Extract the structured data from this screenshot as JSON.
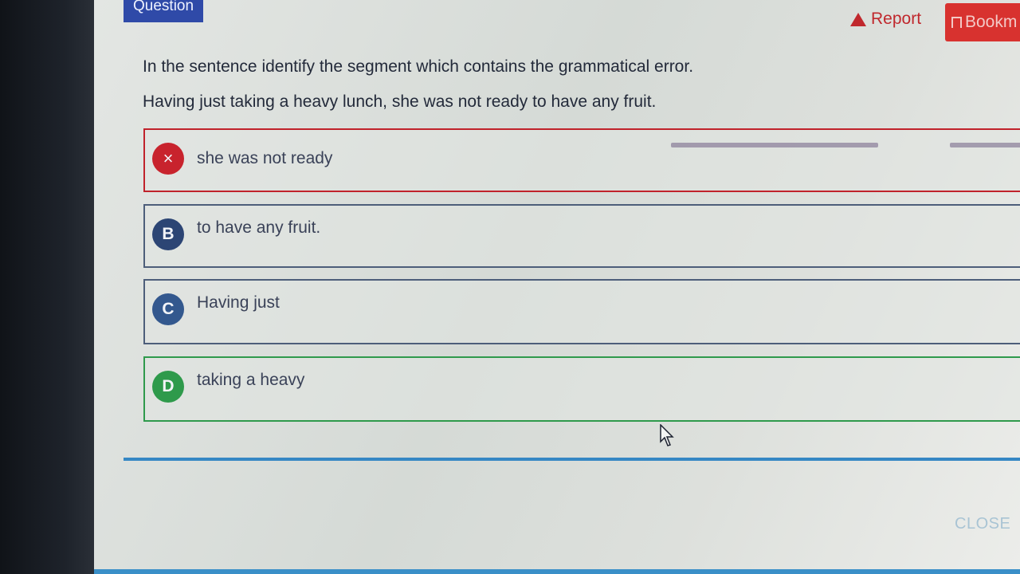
{
  "question_tab": "Question",
  "report_label": "Report",
  "bookmark_label": "Bookm",
  "prompt": "In the sentence identify the segment which contains the grammatical error.",
  "sentence": "Having just taking a heavy lunch, she was not ready to have any fruit.",
  "options": [
    {
      "badge": "×",
      "text": "she was not ready",
      "state": "incorrect"
    },
    {
      "badge": "B",
      "text": "to have any fruit.",
      "state": "neutral"
    },
    {
      "badge": "C",
      "text": "Having just",
      "state": "neutral"
    },
    {
      "badge": "D",
      "text": "taking a heavy",
      "state": "correct"
    }
  ],
  "close_label": "CLOSE",
  "colors": {
    "incorrect": "#c8232d",
    "correct": "#2e9a4b",
    "accent": "#2f4aa8",
    "divider": "#3587c4"
  }
}
